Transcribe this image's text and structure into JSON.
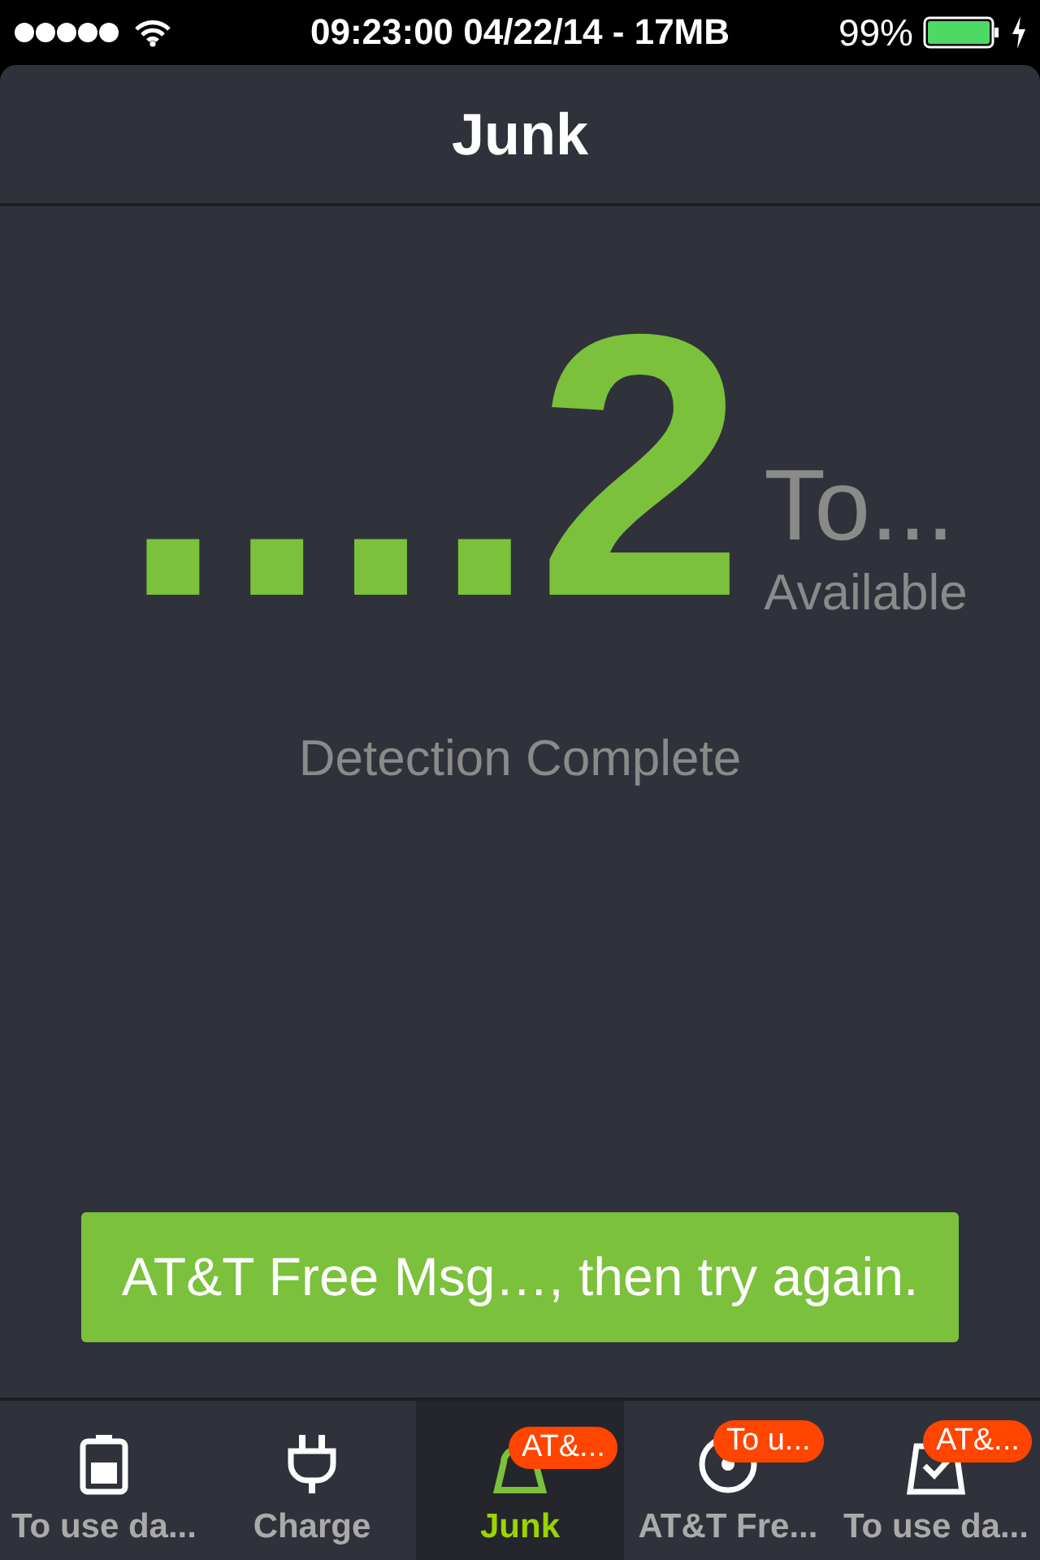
{
  "status_bar": {
    "time": "09:23:00 04/22/14 - 17MB",
    "battery": "99%"
  },
  "header": {
    "title": "Junk"
  },
  "result": {
    "count": "....2",
    "unit": "To...",
    "caption": "Available",
    "status": "Detection Complete"
  },
  "action_button": {
    "label": "AT&T Free Msg…, then try again."
  },
  "tab_bar": [
    {
      "label": "To use da...",
      "selected": false
    },
    {
      "label": "Charge",
      "selected": false
    },
    {
      "label": "Junk",
      "selected": true,
      "badge": "AT&..."
    },
    {
      "label": "AT&T Fre...",
      "selected": false,
      "badge": "To u..."
    },
    {
      "label": "To use da...",
      "selected": false,
      "badge": "AT&..."
    }
  ]
}
